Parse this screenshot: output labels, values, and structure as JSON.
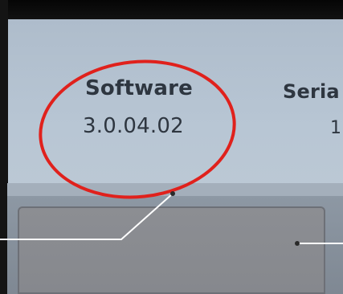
{
  "screen": {
    "software_label": "Software",
    "software_version": "3.0.04.02",
    "serial_label": "Seria",
    "serial_value_partial": "1"
  },
  "annotation": {
    "circle_color": "#e0211c",
    "leader_line_color": "#ffffff"
  }
}
